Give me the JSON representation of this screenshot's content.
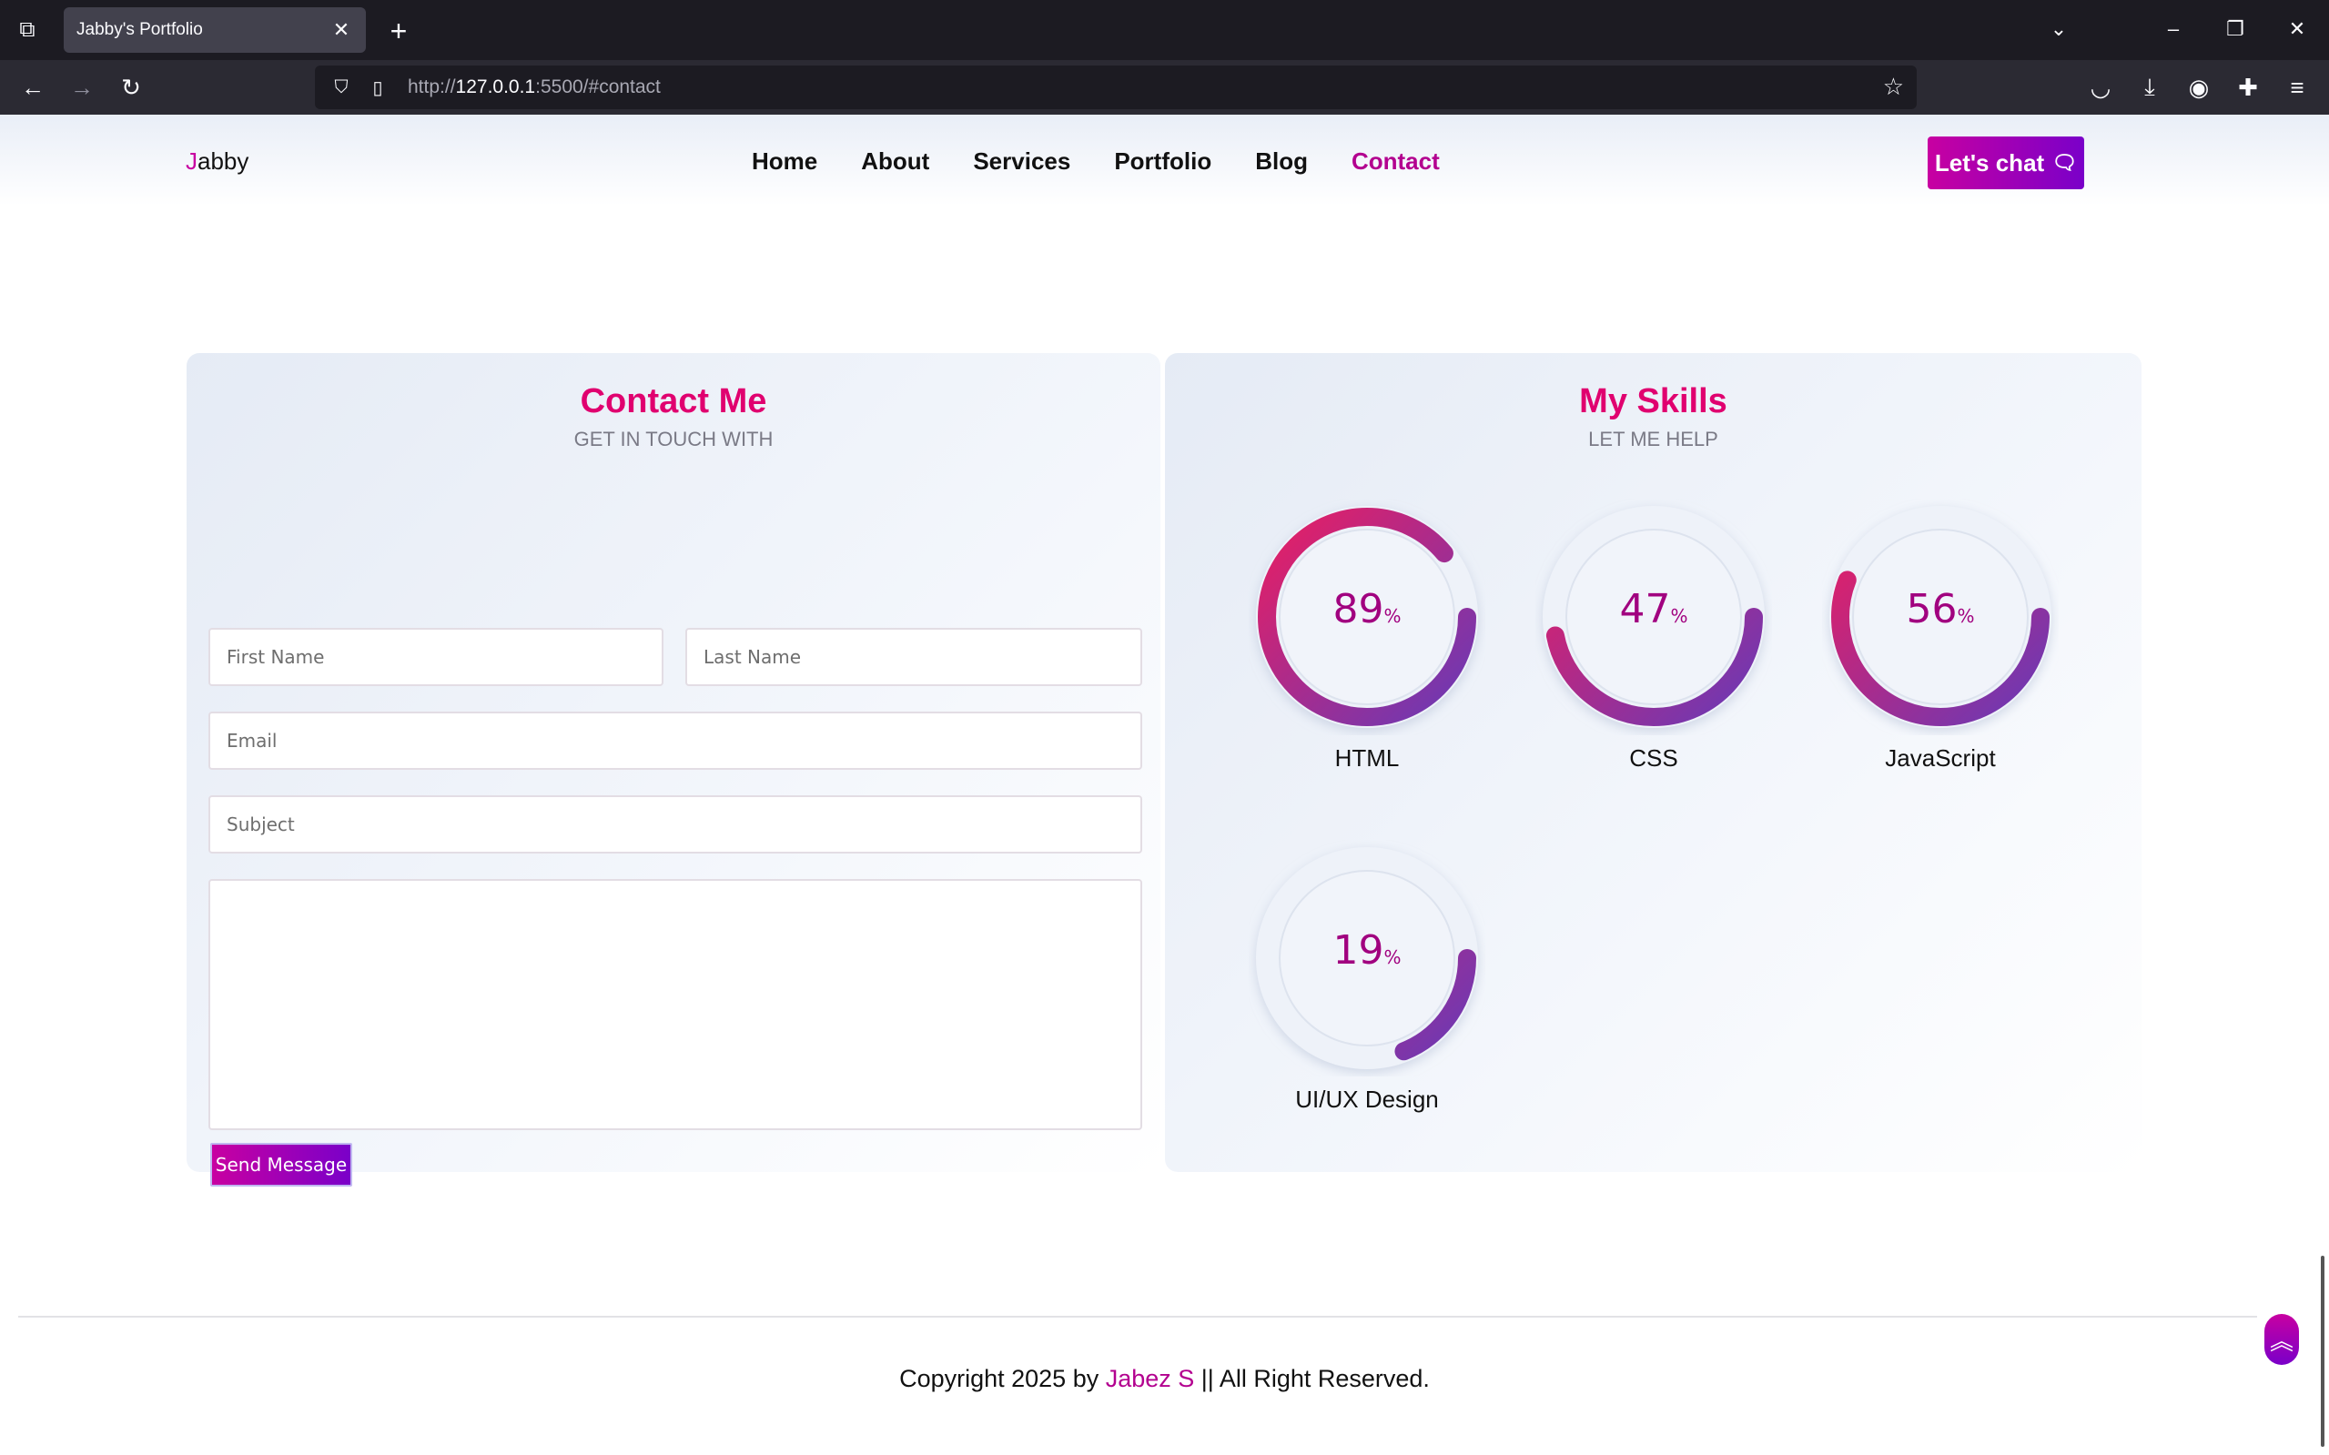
{
  "browser": {
    "tab_title": "Jabby's Portfolio",
    "tab_close": "✕",
    "new_tab": "+",
    "url_prefix": "http://",
    "url_host": "127.0.0.1",
    "url_rest": ":5500/#contact",
    "tab_list_glyph": "⧉",
    "back_glyph": "←",
    "forward_glyph": "→",
    "reload_glyph": "↻",
    "shield_glyph": "⛉",
    "page_glyph": "▯",
    "star_glyph": "☆",
    "list_all_glyph": "⌄",
    "minimize_glyph": "–",
    "restore_glyph": "❐",
    "close_glyph": "✕",
    "pocket_glyph": "◡",
    "download_glyph": "⤓",
    "account_glyph": "◉",
    "extensions_glyph": "✚",
    "menu_glyph": "≡"
  },
  "header": {
    "logo_first": "J",
    "logo_rest": "abby",
    "menu": [
      {
        "label": "Home"
      },
      {
        "label": "About"
      },
      {
        "label": "Services"
      },
      {
        "label": "Portfolio"
      },
      {
        "label": "Blog"
      },
      {
        "label": "Contact",
        "active": true
      }
    ],
    "chat_label": "Let's chat",
    "chat_icon": "🗨"
  },
  "contact": {
    "title": "Contact Me",
    "subtitle": "GET IN TOUCH WITH",
    "first_name_placeholder": "First Name",
    "last_name_placeholder": "Last Name",
    "email_placeholder": "Email",
    "subject_placeholder": "Subject",
    "message_value": "",
    "send_label": "Send Message"
  },
  "skills": {
    "title": "My Skills",
    "subtitle": "LET ME HELP",
    "percent_sign": "%",
    "items": [
      {
        "name": "HTML",
        "percent": 89
      },
      {
        "name": "CSS",
        "percent": 47
      },
      {
        "name": "JavaScript",
        "percent": 56
      },
      {
        "name": "UI/UX Design",
        "percent": 19
      }
    ]
  },
  "footer": {
    "copyright_prefix": "Copyright 2025 by ",
    "author": "Jabez S",
    "copyright_suffix": " || All Right Reserved.",
    "to_top_glyph": "︽"
  },
  "colors": {
    "accent_pink": "#e0006f",
    "accent_purple": "#7a00c9",
    "ring_start": "#e91e63",
    "ring_end": "#673ab7"
  }
}
